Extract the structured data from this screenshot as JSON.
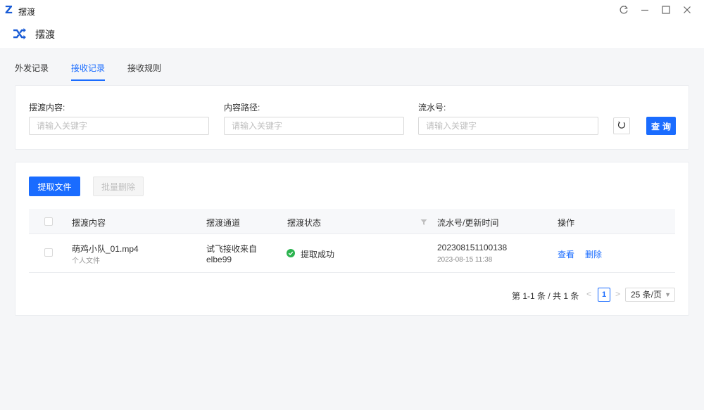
{
  "window": {
    "logo_letter": "Z",
    "title": "摆渡"
  },
  "app": {
    "title": "摆渡",
    "icon": "shuffle-icon"
  },
  "tabs": [
    {
      "label": "外发记录",
      "active": false
    },
    {
      "label": "接收记录",
      "active": true
    },
    {
      "label": "接收规则",
      "active": false
    }
  ],
  "search": {
    "fields": [
      {
        "label": "摆渡内容:",
        "placeholder": "请输入关键字",
        "value": ""
      },
      {
        "label": "内容路径:",
        "placeholder": "请输入关键字",
        "value": ""
      },
      {
        "label": "流水号:",
        "placeholder": "请输入关键字",
        "value": ""
      }
    ],
    "reset_icon": "refresh-icon",
    "query_label": "查询"
  },
  "list": {
    "extract_label": "提取文件",
    "batch_delete_label": "批量删除",
    "columns": [
      "摆渡内容",
      "摆渡通道",
      "摆渡状态",
      "流水号/更新时间",
      "操作"
    ],
    "rows": [
      {
        "name": "萌鸡小队_01.mp4",
        "source": "个人文件",
        "channel_line1": "试飞接收来自",
        "channel_line2": "elbe99",
        "status": "提取成功",
        "serial": "202308151100138",
        "time": "2023-08-15 11:38",
        "action_view": "查看",
        "action_delete": "删除"
      }
    ]
  },
  "pagination": {
    "summary": "第 1-1 条 / 共 1 条",
    "current_page": "1",
    "page_size": "25 条/页"
  },
  "colors": {
    "accent": "#1a6cff",
    "success": "#2bb34f",
    "background": "#f5f6f8"
  }
}
